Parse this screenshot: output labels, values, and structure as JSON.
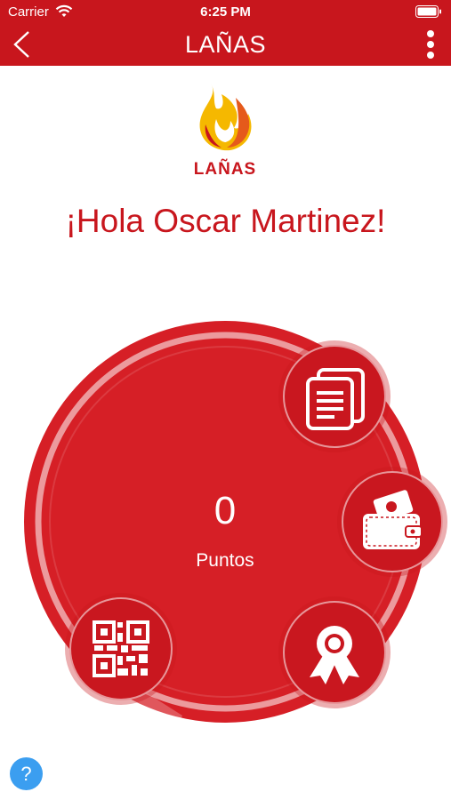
{
  "status_bar": {
    "carrier": "Carrier",
    "time": "6:25 PM",
    "wifi_icon": "wifi-icon",
    "battery_icon": "battery-icon"
  },
  "nav": {
    "title": "LAÑAS",
    "back_icon": "chevron-left-icon",
    "more_icon": "more-vertical-icon"
  },
  "logo": {
    "brand": "LAÑAS",
    "icon": "flame-logo-icon"
  },
  "greeting": "¡Hola Oscar Martinez!",
  "points": {
    "value": "0",
    "label": "Puntos"
  },
  "actions": [
    {
      "name": "documents",
      "icon": "documents-icon"
    },
    {
      "name": "wallet",
      "icon": "wallet-icon"
    },
    {
      "name": "rewards",
      "icon": "award-ribbon-icon"
    },
    {
      "name": "qr-code",
      "icon": "qr-code-icon"
    }
  ],
  "help": {
    "label": "?",
    "icon": "help-icon"
  },
  "colors": {
    "brand_red": "#c8161d",
    "circle_red": "#d61f26",
    "help_blue": "#3b9ef0",
    "flame_yellow": "#f5b800"
  }
}
